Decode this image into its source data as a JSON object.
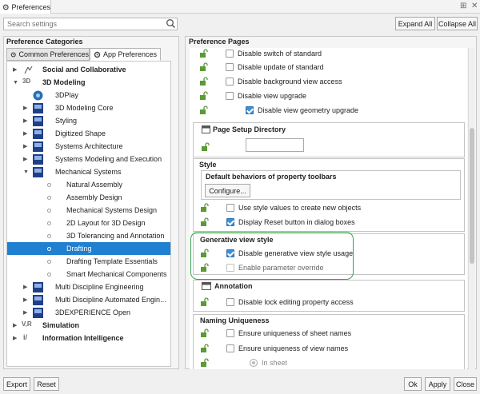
{
  "window": {
    "title": "Preferences",
    "pin": "⊞",
    "close": "✕"
  },
  "search": {
    "placeholder": "Search settings"
  },
  "toolbar": {
    "expand_all": "Expand All",
    "collapse_all": "Collapse All"
  },
  "left": {
    "title": "Preference Categories",
    "tabs": [
      {
        "label": "Common Preferences"
      },
      {
        "label": "App Preferences"
      }
    ],
    "tree": [
      {
        "label": "Social and Collaborative",
        "icon": "social-icon",
        "bold": true,
        "level": 0,
        "expander": "collapsed"
      },
      {
        "label": "3D Modeling",
        "icon": "3d-icon",
        "bold": true,
        "level": 0,
        "expander": "expanded"
      },
      {
        "label": "3DPlay",
        "icon": "3dplay-icon",
        "level": 1
      },
      {
        "label": "3D Modeling Core",
        "icon": "app-icon",
        "level": 1,
        "expander": "collapsed"
      },
      {
        "label": "Styling",
        "icon": "app-icon",
        "level": 1,
        "expander": "collapsed"
      },
      {
        "label": "Digitized Shape",
        "icon": "app-icon",
        "level": 1,
        "expander": "collapsed"
      },
      {
        "label": "Systems Architecture",
        "icon": "app-icon",
        "level": 1,
        "expander": "collapsed"
      },
      {
        "label": "Systems Modeling and Execution",
        "icon": "app-icon",
        "level": 1,
        "expander": "collapsed"
      },
      {
        "label": "Mechanical Systems",
        "icon": "app-icon",
        "level": 1,
        "expander": "expanded"
      },
      {
        "label": "Natural Assembly",
        "level": 2
      },
      {
        "label": "Assembly Design",
        "level": 2
      },
      {
        "label": "Mechanical Systems Design",
        "level": 2
      },
      {
        "label": "2D Layout for 3D Design",
        "level": 2
      },
      {
        "label": "3D Tolerancing and Annotation",
        "level": 2
      },
      {
        "label": "Drafting",
        "level": 2,
        "selected": true
      },
      {
        "label": "Drafting Template Essentials",
        "level": 2
      },
      {
        "label": "Smart Mechanical Components",
        "level": 2
      },
      {
        "label": "Multi Discipline Engineering",
        "icon": "app-icon",
        "level": 1,
        "expander": "collapsed"
      },
      {
        "label": "Multi Discipline Automated Engin...",
        "icon": "app-icon",
        "level": 1,
        "expander": "collapsed"
      },
      {
        "label": "3DEXPERIENCE Open",
        "icon": "app-icon",
        "level": 1,
        "expander": "collapsed"
      },
      {
        "label": "Simulation",
        "icon": "vr-icon",
        "bold": true,
        "level": 0,
        "expander": "collapsed"
      },
      {
        "label": "Information Intelligence",
        "icon": "info-icon",
        "bold": true,
        "level": 0,
        "expander": "collapsed"
      }
    ]
  },
  "right": {
    "title": "Preference Pages",
    "standard_options": [
      {
        "label": "Disable switch of standard",
        "checked": false
      },
      {
        "label": "Disable update of standard",
        "checked": false
      },
      {
        "label": "Disable background view access",
        "checked": false
      },
      {
        "label": "Disable view upgrade",
        "checked": false
      },
      {
        "label": "Disable view geometry upgrade",
        "checked": true
      }
    ],
    "page_setup": {
      "title": "Page Setup Directory",
      "value": ""
    },
    "style": {
      "title": "Style",
      "subgroup_title": "Default behaviors of property toolbars",
      "configure": "Configure...",
      "options": [
        {
          "label": "Use style values to create new objects",
          "checked": false
        },
        {
          "label": "Display Reset button in dialog boxes",
          "checked": true
        }
      ]
    },
    "generative": {
      "title": "Generative view style",
      "options": [
        {
          "label": "Disable generative view style usage",
          "checked": true
        },
        {
          "label": "Enable parameter override",
          "checked": false
        }
      ]
    },
    "annotation": {
      "title": "Annotation",
      "options": [
        {
          "label": "Disable lock editing property access",
          "checked": false
        }
      ]
    },
    "naming": {
      "title": "Naming Uniqueness",
      "options": [
        {
          "label": "Ensure uniqueness of sheet names",
          "checked": false
        },
        {
          "label": "Ensure uniqueness of view names",
          "checked": false
        }
      ],
      "radio": "In sheet"
    }
  },
  "footer": {
    "export": "Export",
    "reset": "Reset",
    "ok": "Ok",
    "apply": "Apply",
    "close": "Close"
  },
  "colors": {
    "selection": "#1f7fd0",
    "highlight_ring": "#3aa24a",
    "check": "#3a8fd9"
  }
}
